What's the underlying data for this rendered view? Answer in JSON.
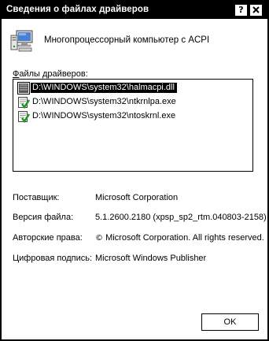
{
  "window": {
    "title": "Сведения о файлах драйверов",
    "help_label": "?",
    "close_label": "✕"
  },
  "device": {
    "icon": "computer-icon",
    "name": "Многопроцессорный компьютер с ACPI"
  },
  "files": {
    "label_mnemonic": "Ф",
    "label_rest": "айлы драйверов:",
    "items": [
      {
        "path": "D:\\WINDOWS\\system32\\halmacpi.dll",
        "icon": "unsigned-file-icon",
        "selected": true
      },
      {
        "path": "D:\\WINDOWS\\system32\\ntkrnlpa.exe",
        "icon": "signed-file-icon",
        "selected": false
      },
      {
        "path": "D:\\WINDOWS\\system32\\ntoskrnl.exe",
        "icon": "signed-file-icon",
        "selected": false
      }
    ]
  },
  "details": {
    "provider_label": "Поставщик:",
    "provider_value": "Microsoft Corporation",
    "version_label": "Версия файла:",
    "version_value": "5.1.2600.2180 (xpsp_sp2_rtm.040803-2158)",
    "copyright_label": "Авторские права:",
    "copyright_symbol": "©",
    "copyright_value": "Microsoft Corporation. All rights reserved.",
    "signer_label": "Цифровая подпись:",
    "signer_value": "Microsoft Windows Publisher"
  },
  "buttons": {
    "ok_label": "OK"
  },
  "colors": {
    "titlebar": "#000000",
    "background": "#ffffff",
    "selection": "#000000"
  }
}
